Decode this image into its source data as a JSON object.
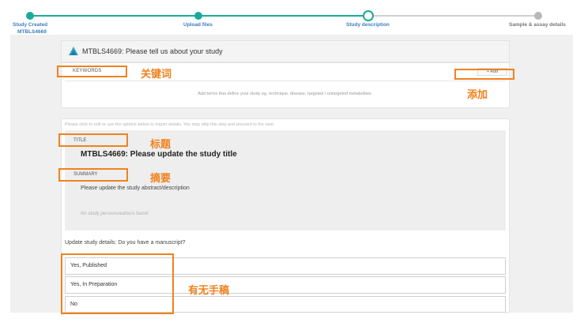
{
  "stepper": {
    "steps": [
      {
        "label": "Study Created",
        "sublabel": "MTBLS4669",
        "state": "done"
      },
      {
        "label": "Upload files",
        "state": "done"
      },
      {
        "label": "Study description",
        "state": "active"
      },
      {
        "label": "Sample & assay details",
        "state": "todo"
      }
    ]
  },
  "header": {
    "title": "MTBLS4669: Please tell us about your study"
  },
  "keywords": {
    "label": "KEYWORDS",
    "add_label": "+ Add",
    "hint": "Add terms that define your study eg. technique, disease, targeted / untargeted metabolites"
  },
  "edit_hint": "Please click to edit or use the options below to import details. You may skip this step and proceed to the next.",
  "details": {
    "title_label": "TITLE",
    "title_value": "MTBLS4669: Please update the study title",
    "summary_label": "SUMMARY",
    "summary_value": "Please update the study abstract/description",
    "no_persons": "No study persons/authors found"
  },
  "manuscript": {
    "question": "Update study details: Do you have a manuscript?",
    "options": [
      "Yes, Published",
      "Yes, In Preparation",
      "No"
    ]
  },
  "annotations": {
    "keywords": "关键词",
    "add": "添加",
    "title": "标题",
    "summary": "摘要",
    "manuscript": "有无手稿"
  },
  "colors": {
    "accent": "#1aa99b",
    "link": "#3a7ec1",
    "annotation": "#f0821e"
  }
}
